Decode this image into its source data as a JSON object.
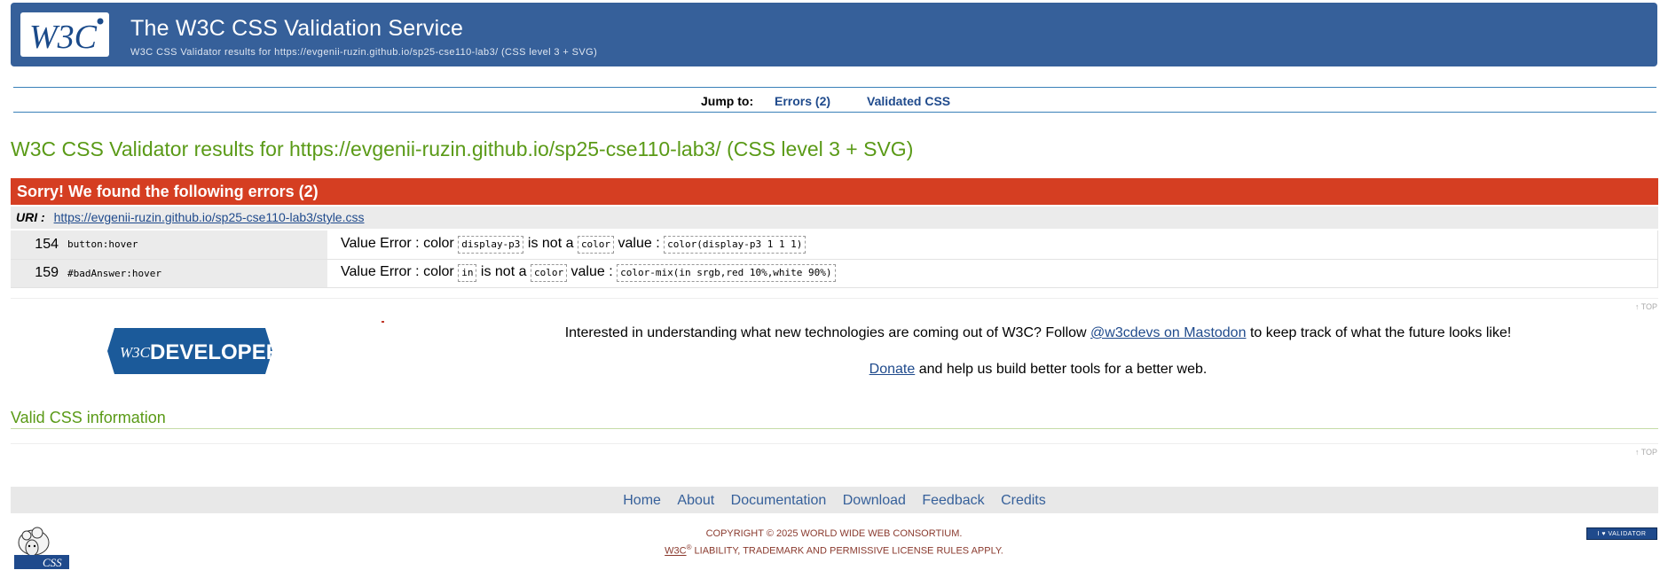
{
  "banner": {
    "logo_text": "W3C",
    "title": "The W3C CSS Validation Service",
    "subtitle": "W3C CSS Validator results for https://evgenii-ruzin.github.io/sp25-cse110-lab3/ (CSS level 3 + SVG)"
  },
  "jump": {
    "label": "Jump to:",
    "errors": "Errors (2)",
    "validated": "Validated CSS"
  },
  "results_heading": "W3C CSS Validator results for https://evgenii-ruzin.github.io/sp25-cse110-lab3/ (CSS level 3 + SVG)",
  "errors": {
    "header": "Sorry! We found the following errors (2)",
    "uri_label": "URI :",
    "uri": "https://evgenii-ruzin.github.io/sp25-cse110-lab3/style.css",
    "rows": [
      {
        "line": "154",
        "context": "button:hover",
        "prefix": "Value Error : color",
        "token1": "display-p3",
        "mid1": "is not a",
        "token2": "color",
        "mid2": "value :",
        "value": "color(display-p3 1 1 1)"
      },
      {
        "line": "159",
        "context": "#badAnswer:hover",
        "prefix": "Value Error : color",
        "token1": "in",
        "mid1": "is not a",
        "token2": "color",
        "mid2": "value :",
        "value": "color-mix(in srgb,red 10%,white 90%)"
      }
    ]
  },
  "top_link": "↑ TOP",
  "promo": {
    "dev_logo_w3c": "W3C",
    "dev_logo_text": "DEVELOPERS",
    "text_before": "Interested in understanding what new technologies are coming out of W3C? Follow",
    "link": "@w3cdevs on Mastodon",
    "text_after": "to keep track of what the future looks like!",
    "donate_link": "Donate",
    "donate_text": "and help us build better tools for a better web."
  },
  "valid_heading": "Valid CSS information",
  "footer": {
    "nav": [
      "Home",
      "About",
      "Documentation",
      "Download",
      "Feedback",
      "Credits"
    ],
    "copyright_prefix": "COPYRIGHT © 2025",
    "copyright_org": "WORLD WIDE WEB CONSORTIUM",
    "copyright_suffix": ".",
    "license_w3c": "W3C",
    "license_reg": "®",
    "license_liability": "LIABILITY",
    "license_trademark": "TRADEMARK",
    "license_and": "AND",
    "license_permissive": "PERMISSIVE LICENSE",
    "license_rules": "RULES APPLY.",
    "badge": "I ♥ VALIDATOR",
    "sheep_label": "CSS"
  },
  "colors": {
    "banner_bg": "#36609a",
    "error_red": "#d53e22",
    "heading_green": "#5a9a17",
    "link_blue": "#1f4a8c"
  }
}
